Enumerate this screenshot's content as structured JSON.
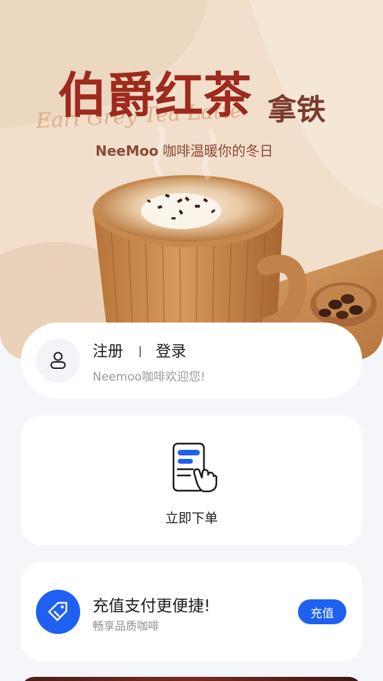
{
  "hero": {
    "title_main": "伯爵红茶",
    "title_sub": "拿铁",
    "title_script": "Earl Grey Tea Latte",
    "brand": "NeeMoo",
    "tagline": "咖啡温暖你的冬日"
  },
  "user": {
    "register_label": "注册",
    "separator": "|",
    "login_label": "登录",
    "welcome": "Neemoo咖啡欢迎您!",
    "avatar_icon": "user-icon"
  },
  "order": {
    "label": "立即下单",
    "icon": "tap-phone-icon"
  },
  "recharge": {
    "title": "充值支付更便捷!",
    "subtitle": "畅享品质咖啡",
    "button_label": "充值",
    "icon": "tag-icon"
  },
  "colors": {
    "accent": "#1f60f0",
    "hero_bg": "#f1dfcb",
    "title_red": "#9e2a1e",
    "page_bg": "#f5f6fa"
  }
}
